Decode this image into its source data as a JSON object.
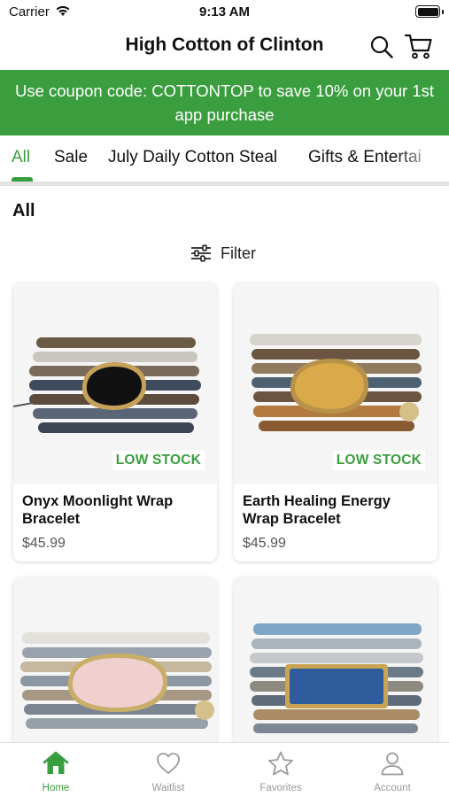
{
  "status_bar": {
    "carrier": "Carrier",
    "time": "9:13 AM"
  },
  "header": {
    "title": "High Cotton of Clinton"
  },
  "banner": {
    "text": "Use coupon code: COTTONTOP to save 10% on your 1st app purchase"
  },
  "categories": [
    {
      "label": "All",
      "active": true
    },
    {
      "label": "Sale",
      "active": false
    },
    {
      "label": "July Daily Cotton Steal",
      "active": false
    },
    {
      "label": "Gifts & Entertai",
      "active": false
    }
  ],
  "section_title": "All",
  "filter": {
    "label": "Filter"
  },
  "products": [
    {
      "name": "Onyx Moonlight Wrap Bracelet",
      "price": "$45.99",
      "badge": "LOW STOCK",
      "stone_color": "#111111"
    },
    {
      "name": "Earth Healing Energy Wrap Bracelet",
      "price": "$45.99",
      "badge": "LOW STOCK",
      "stone_color": "#d9a94a"
    },
    {
      "name": "",
      "price": "",
      "badge": "",
      "stone_color": "#f0cfcf"
    },
    {
      "name": "",
      "price": "",
      "badge": "",
      "stone_color": "#2f5c9c"
    }
  ],
  "tab_bar": {
    "home": "Home",
    "waitlist": "Waitlist",
    "favorites": "Favorites",
    "account": "Account"
  },
  "colors": {
    "accent": "#3a9e3f",
    "inactive": "#999999"
  }
}
